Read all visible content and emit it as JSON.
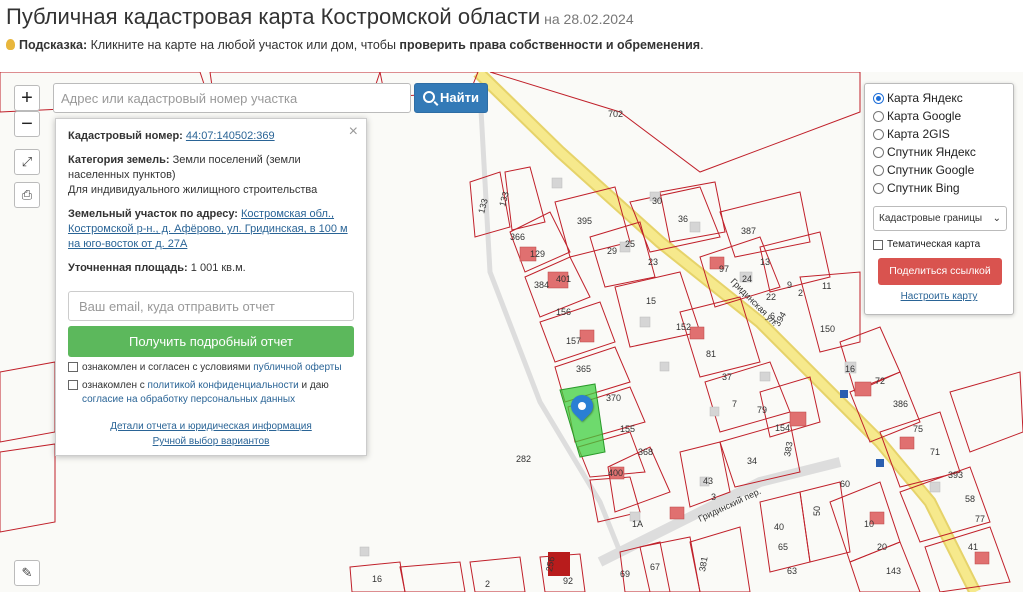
{
  "header": {
    "title": "Публичная кадастровая карта Костромской области",
    "date": "на 28.02.2024"
  },
  "hint": {
    "label": "Подсказка:",
    "text": " Кликните на карте на любой участок или дом, чтобы ",
    "emphasis": "проверить права собственности и обременения",
    "end": "."
  },
  "search": {
    "placeholder": "Адрес или кадастровый номер участка",
    "button_label": "Найти",
    "button_icon": "search-icon"
  },
  "map_controls": {
    "zoom_in": "+",
    "zoom_out": "−",
    "fullscreen_icon": "expand-icon",
    "print_icon": "printer-icon",
    "ruler_icon": "ruler-icon"
  },
  "popup": {
    "cadastral_label": "Кадастровый номер:",
    "cadastral_value": "44:07:140502:369",
    "category_label": "Категория земель:",
    "category_value": "Земли поселений (земли населенных пунктов)",
    "usage_value": "Для индивидуального жилищного строительства",
    "address_label": "Земельный участок по адресу:",
    "address_value": "Костромская обл., Костромской р-н., д. Афёрово, ул. Гридинская, в 100 м на юго-восток от д. 27А",
    "area_label": "Уточненная площадь:",
    "area_value": "1 001 кв.м.",
    "email_placeholder": "Ваш email, куда отправить отчет",
    "report_button": "Получить подробный отчет",
    "agree1_text": "ознакомлен и согласен с условиями ",
    "agree1_link": "публичной оферты",
    "agree2_text": "ознакомлен с ",
    "agree2_link": "политикой конфиденциальности",
    "agree2_text2": " и даю ",
    "agree2_link2": "согласие на обработку персональных данных",
    "details_link": "Детали отчета и юридическая информация",
    "manual_link": "Ручной выбор вариантов",
    "close": "×"
  },
  "layers": {
    "options": [
      {
        "label": "Карта Яндекс",
        "selected": true
      },
      {
        "label": "Карта Google",
        "selected": false
      },
      {
        "label": "Карта 2GIS",
        "selected": false
      },
      {
        "label": "Спутник Яндекс",
        "selected": false
      },
      {
        "label": "Спутник Google",
        "selected": false
      },
      {
        "label": "Спутник Bing",
        "selected": false
      }
    ],
    "overlay_select": "Кадастровые границы",
    "thematic_label": "Тематическая карта",
    "share_button": "Поделиться ссылкой",
    "configure_link": "Настроить карту"
  },
  "map": {
    "street_main": "Гридинская ул.",
    "street_side": "Гридинский пер.",
    "selected_plot": "369",
    "plot_labels": [
      "702",
      "133",
      "133",
      "366",
      "129",
      "401",
      "384",
      "395",
      "29",
      "25",
      "23",
      "30",
      "36",
      "387",
      "97",
      "13",
      "24",
      "22",
      "6",
      "9",
      "2",
      "11",
      "394",
      "150",
      "15",
      "152",
      "156",
      "157",
      "81",
      "365",
      "370",
      "155",
      "37",
      "7",
      "79",
      "154",
      "383",
      "368",
      "400",
      "282",
      "34",
      "43",
      "3",
      "60",
      "50",
      "1А",
      "40",
      "65",
      "63",
      "67",
      "381",
      "16",
      "2",
      "92",
      "256",
      "69",
      "72",
      "386",
      "75",
      "71",
      "393",
      "58",
      "77",
      "41",
      "10",
      "20",
      "143"
    ]
  },
  "colors": {
    "accent_blue": "#337ab7",
    "green_button": "#5cb85c",
    "red_button": "#d9534f",
    "plot_border": "#c0202a",
    "road": "#f4e27a",
    "selected_fill": "#3fcf3f"
  }
}
